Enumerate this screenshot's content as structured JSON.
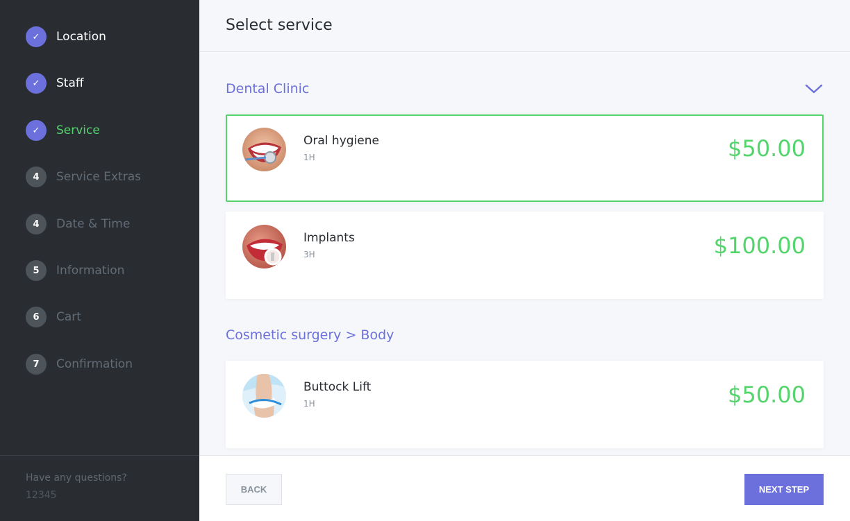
{
  "sidebar": {
    "steps": [
      {
        "badge": "✓",
        "label": "Location",
        "state": "done"
      },
      {
        "badge": "✓",
        "label": "Staff",
        "state": "done"
      },
      {
        "badge": "✓",
        "label": "Service",
        "state": "active"
      },
      {
        "badge": "4",
        "label": "Service Extras",
        "state": "todo"
      },
      {
        "badge": "4",
        "label": "Date & Time",
        "state": "todo"
      },
      {
        "badge": "5",
        "label": "Information",
        "state": "todo"
      },
      {
        "badge": "6",
        "label": "Cart",
        "state": "todo"
      },
      {
        "badge": "7",
        "label": "Confirmation",
        "state": "todo"
      }
    ],
    "help_title": "Have any questions?",
    "help_phone": "12345"
  },
  "header": {
    "title": "Select service"
  },
  "categories": [
    {
      "name": "Dental Clinic",
      "services": [
        {
          "name": "Oral hygiene",
          "duration": "1H",
          "price": "$50.00",
          "selected": true,
          "image": "smiling-mouth-mirror"
        },
        {
          "name": "Implants",
          "duration": "3H",
          "price": "$100.00",
          "selected": false,
          "image": "lips-magnifier"
        }
      ]
    },
    {
      "name": "Cosmetic surgery > Body",
      "services": [
        {
          "name": "Buttock Lift",
          "duration": "1H",
          "price": "$50.00",
          "selected": false,
          "image": "body-measuring-tape"
        }
      ]
    }
  ],
  "footer": {
    "back_label": "BACK",
    "next_label": "NEXT STEP"
  },
  "colors": {
    "accent": "#6c70dc",
    "success": "#53d56c",
    "sidebar_bg": "#292d32",
    "content_bg": "#f5f7fa"
  }
}
